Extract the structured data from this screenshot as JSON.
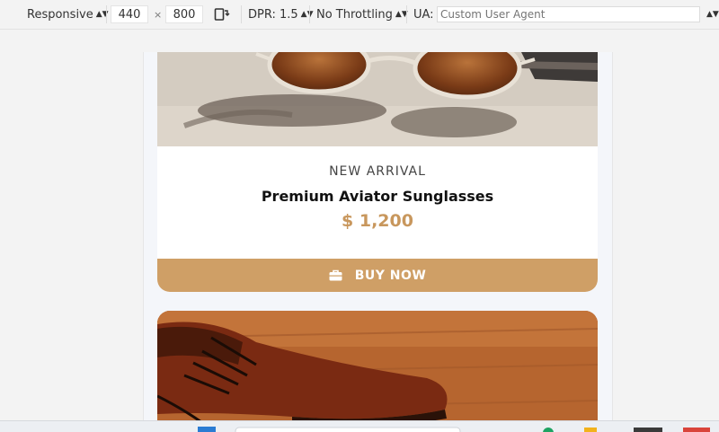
{
  "toolbar": {
    "device": "Responsive",
    "width": "440",
    "times": "×",
    "height": "800",
    "dpr": "DPR: 1.5",
    "throttling": "No Throttling",
    "ua_label": "UA:",
    "ua_placeholder": "Custom User Agent"
  },
  "product": {
    "category": "NEW ARRIVAL",
    "title": "Premium Aviator Sunglasses",
    "price": "$ 1,200",
    "buy_label": "BUY NOW"
  },
  "colors": {
    "accent": "#cf9f66",
    "price": "#c8975d"
  },
  "icons": {
    "rotate": "rotate-device-icon",
    "bag": "shopping-bag-icon"
  }
}
